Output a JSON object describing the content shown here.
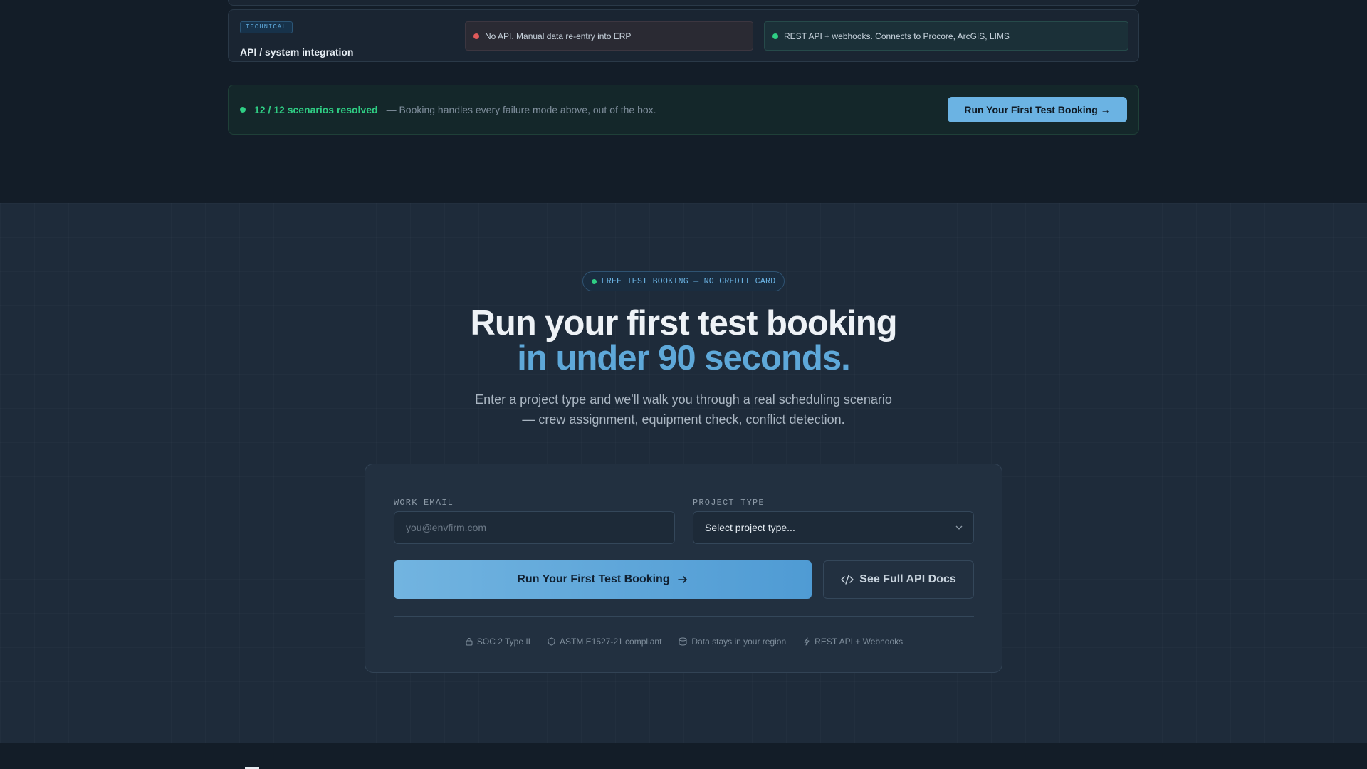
{
  "integration_row": {
    "badge": "TECHNICAL",
    "title": "API / system integration",
    "without": "No API. Manual data re-entry into ERP",
    "with": "REST API + webhooks. Connects to Procore, ArcGIS, LIMS"
  },
  "resolved": {
    "count_text": "12 / 12 scenarios resolved",
    "detail": "— Booking handles every failure mode above, out of the box.",
    "cta_label": "Run Your First Test Booking →"
  },
  "cta": {
    "pill": "FREE TEST BOOKING — NO CREDIT CARD",
    "headline_line1": "Run your first test booking",
    "headline_line2": "in under 90 seconds.",
    "subtitle": "Enter a project type and we'll walk you through a real scheduling scenario — crew assignment, equipment check, conflict detection."
  },
  "form": {
    "email_label": "WORK EMAIL",
    "email_placeholder": "you@envfirm.com",
    "email_value": "",
    "project_label": "PROJECT TYPE",
    "project_selected": "Select project type...",
    "primary_button": "Run Your First Test Booking",
    "secondary_button": "See Full API Docs"
  },
  "trust_badges": [
    {
      "icon": "lock-icon",
      "label": "SOC 2 Type II"
    },
    {
      "icon": "shield-icon",
      "label": "ASTM E1527-21 compliant"
    },
    {
      "icon": "database-icon",
      "label": "Data stays in your region"
    },
    {
      "icon": "lightning-icon",
      "label": "REST API + Webhooks"
    }
  ],
  "colors": {
    "accent": "#5ea8d9",
    "success": "#2fce84",
    "danger": "#e05a5a",
    "background": "#131d28",
    "section": "#1e2b3a"
  }
}
